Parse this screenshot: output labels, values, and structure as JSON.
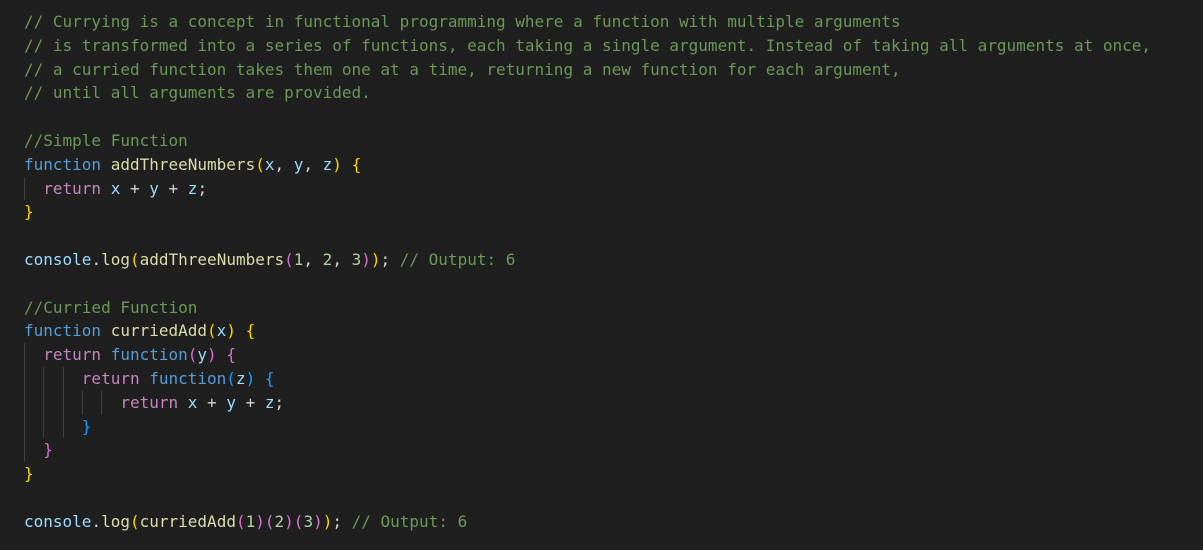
{
  "lines": [
    {
      "tokens": [
        {
          "t": "// Currying is a concept in functional programming where a function with multiple arguments",
          "c": "cm"
        }
      ]
    },
    {
      "tokens": [
        {
          "t": "// is transformed into a series of functions, each taking a single argument. Instead of taking all arguments at once,",
          "c": "cm"
        }
      ]
    },
    {
      "tokens": [
        {
          "t": "// a curried function takes them one at a time, returning a new function for each argument,",
          "c": "cm"
        }
      ]
    },
    {
      "tokens": [
        {
          "t": "// until all arguments are provided.",
          "c": "cm"
        }
      ]
    },
    {
      "tokens": []
    },
    {
      "tokens": [
        {
          "t": "//Simple Function",
          "c": "cm"
        }
      ]
    },
    {
      "tokens": [
        {
          "t": "function",
          "c": "kw"
        },
        {
          "t": " ",
          "c": "op"
        },
        {
          "t": "addThreeNumbers",
          "c": "fn"
        },
        {
          "t": "(",
          "c": "b1"
        },
        {
          "t": "x",
          "c": "var"
        },
        {
          "t": ", ",
          "c": "op"
        },
        {
          "t": "y",
          "c": "var"
        },
        {
          "t": ", ",
          "c": "op"
        },
        {
          "t": "z",
          "c": "var"
        },
        {
          "t": ")",
          "c": "b1"
        },
        {
          "t": " ",
          "c": "op"
        },
        {
          "t": "{",
          "c": "b1"
        }
      ]
    },
    {
      "indent": 2,
      "tokens": [
        {
          "t": "return",
          "c": "ctl"
        },
        {
          "t": " ",
          "c": "op"
        },
        {
          "t": "x",
          "c": "var"
        },
        {
          "t": " + ",
          "c": "op"
        },
        {
          "t": "y",
          "c": "var"
        },
        {
          "t": " + ",
          "c": "op"
        },
        {
          "t": "z",
          "c": "var"
        },
        {
          "t": ";",
          "c": "op"
        }
      ]
    },
    {
      "tokens": [
        {
          "t": "}",
          "c": "b1"
        }
      ]
    },
    {
      "tokens": []
    },
    {
      "tokens": [
        {
          "t": "console",
          "c": "var"
        },
        {
          "t": ".",
          "c": "op"
        },
        {
          "t": "log",
          "c": "fn"
        },
        {
          "t": "(",
          "c": "b1"
        },
        {
          "t": "addThreeNumbers",
          "c": "fn"
        },
        {
          "t": "(",
          "c": "b2"
        },
        {
          "t": "1",
          "c": "num"
        },
        {
          "t": ", ",
          "c": "op"
        },
        {
          "t": "2",
          "c": "num"
        },
        {
          "t": ", ",
          "c": "op"
        },
        {
          "t": "3",
          "c": "num"
        },
        {
          "t": ")",
          "c": "b2"
        },
        {
          "t": ")",
          "c": "b1"
        },
        {
          "t": "; ",
          "c": "op"
        },
        {
          "t": "// Output: 6",
          "c": "cm"
        }
      ]
    },
    {
      "tokens": []
    },
    {
      "tokens": [
        {
          "t": "//Curried Function",
          "c": "cm"
        }
      ]
    },
    {
      "tokens": [
        {
          "t": "function",
          "c": "kw"
        },
        {
          "t": " ",
          "c": "op"
        },
        {
          "t": "curriedAdd",
          "c": "fn"
        },
        {
          "t": "(",
          "c": "b1"
        },
        {
          "t": "x",
          "c": "var"
        },
        {
          "t": ")",
          "c": "b1"
        },
        {
          "t": " ",
          "c": "op"
        },
        {
          "t": "{",
          "c": "b1"
        }
      ]
    },
    {
      "indent": 2,
      "tokens": [
        {
          "t": "return",
          "c": "ctl"
        },
        {
          "t": " ",
          "c": "op"
        },
        {
          "t": "function",
          "c": "kw"
        },
        {
          "t": "(",
          "c": "b2"
        },
        {
          "t": "y",
          "c": "var"
        },
        {
          "t": ")",
          "c": "b2"
        },
        {
          "t": " ",
          "c": "op"
        },
        {
          "t": "{",
          "c": "b2"
        }
      ]
    },
    {
      "indent": 6,
      "tokens": [
        {
          "t": "return",
          "c": "ctl"
        },
        {
          "t": " ",
          "c": "op"
        },
        {
          "t": "function",
          "c": "kw"
        },
        {
          "t": "(",
          "c": "b3"
        },
        {
          "t": "z",
          "c": "var"
        },
        {
          "t": ")",
          "c": "b3"
        },
        {
          "t": " ",
          "c": "op"
        },
        {
          "t": "{",
          "c": "b3"
        }
      ]
    },
    {
      "indent": 10,
      "tokens": [
        {
          "t": "return",
          "c": "ctl"
        },
        {
          "t": " ",
          "c": "op"
        },
        {
          "t": "x",
          "c": "var"
        },
        {
          "t": " + ",
          "c": "op"
        },
        {
          "t": "y",
          "c": "var"
        },
        {
          "t": " + ",
          "c": "op"
        },
        {
          "t": "z",
          "c": "var"
        },
        {
          "t": ";",
          "c": "op"
        }
      ]
    },
    {
      "indent": 6,
      "tokens": [
        {
          "t": "}",
          "c": "b3"
        }
      ]
    },
    {
      "indent": 2,
      "tokens": [
        {
          "t": "}",
          "c": "b2"
        }
      ]
    },
    {
      "tokens": [
        {
          "t": "}",
          "c": "b1"
        }
      ]
    },
    {
      "tokens": []
    },
    {
      "tokens": [
        {
          "t": "console",
          "c": "var"
        },
        {
          "t": ".",
          "c": "op"
        },
        {
          "t": "log",
          "c": "fn"
        },
        {
          "t": "(",
          "c": "b1"
        },
        {
          "t": "curriedAdd",
          "c": "fn"
        },
        {
          "t": "(",
          "c": "b2"
        },
        {
          "t": "1",
          "c": "num"
        },
        {
          "t": ")",
          "c": "b2"
        },
        {
          "t": "(",
          "c": "b2"
        },
        {
          "t": "2",
          "c": "num"
        },
        {
          "t": ")",
          "c": "b2"
        },
        {
          "t": "(",
          "c": "b2"
        },
        {
          "t": "3",
          "c": "num"
        },
        {
          "t": ")",
          "c": "b2"
        },
        {
          "t": ")",
          "c": "b1"
        },
        {
          "t": "; ",
          "c": "op"
        },
        {
          "t": "// Output: 6",
          "c": "cm"
        }
      ]
    }
  ]
}
